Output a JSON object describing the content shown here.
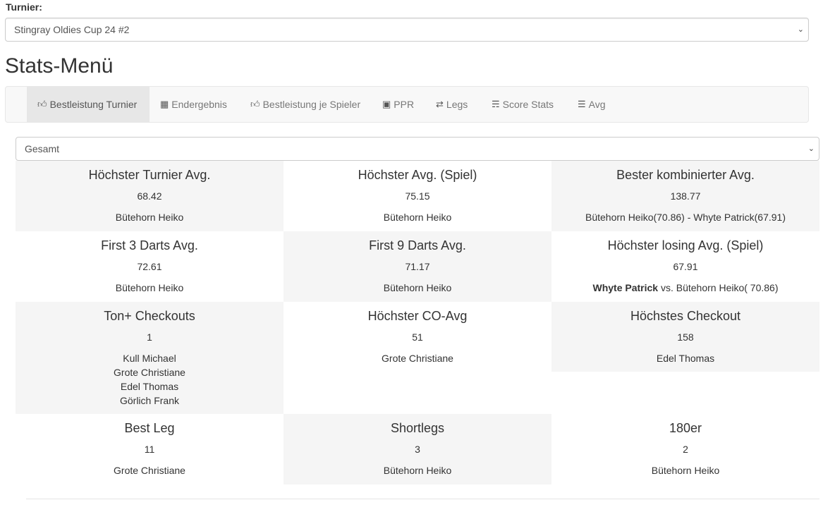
{
  "turnier": {
    "label": "Turnier:",
    "selected": "Stingray Oldies Cup 24 #2"
  },
  "page_title": "Stats-Menü",
  "nav": [
    {
      "label": "Bestleistung Turnier",
      "icon": "thumbs-up-icon",
      "active": true
    },
    {
      "label": "Endergebnis",
      "icon": "calendar-icon",
      "active": false
    },
    {
      "label": "Bestleistung je Spieler",
      "icon": "thumbs-up-icon",
      "active": false
    },
    {
      "label": "PPR",
      "icon": "ppr-icon",
      "active": false
    },
    {
      "label": "Legs",
      "icon": "random-icon",
      "active": false
    },
    {
      "label": "Score Stats",
      "icon": "tasks-icon",
      "active": false
    },
    {
      "label": "Avg",
      "icon": "list-icon",
      "active": false
    }
  ],
  "filter": {
    "selected": "Gesamt"
  },
  "stats": [
    {
      "title": "Höchster Turnier Avg.",
      "value": "68.42",
      "names": [
        "Bütehorn Heiko"
      ]
    },
    {
      "title": "Höchster Avg. (Spiel)",
      "value": "75.15",
      "names": [
        "Bütehorn Heiko"
      ]
    },
    {
      "title": "Bester kombinierter Avg.",
      "value": "138.77",
      "names": [
        "Bütehorn Heiko(70.86) - Whyte Patrick(67.91)"
      ]
    },
    {
      "title": "First 3 Darts Avg.",
      "value": "72.61",
      "names": [
        "Bütehorn Heiko"
      ]
    },
    {
      "title": "First 9 Darts Avg.",
      "value": "71.17",
      "names": [
        "Bütehorn Heiko"
      ]
    },
    {
      "title": "Höchster losing Avg. (Spiel)",
      "value": "67.91",
      "loser": "Whyte Patrick",
      "rest": " vs. Bütehorn Heiko( 70.86)"
    },
    {
      "title": "Ton+ Checkouts",
      "value": "1",
      "names": [
        "Kull Michael",
        "Grote Christiane",
        "Edel Thomas",
        "Görlich Frank"
      ]
    },
    {
      "title": "Höchster CO-Avg",
      "value": "51",
      "names": [
        "Grote Christiane"
      ]
    },
    {
      "title": "Höchstes Checkout",
      "value": "158",
      "names": [
        "Edel Thomas"
      ]
    },
    {
      "title": "Best Leg",
      "value": "11",
      "names": [
        "Grote Christiane"
      ]
    },
    {
      "title": "Shortlegs",
      "value": "3",
      "names": [
        "Bütehorn Heiko"
      ]
    },
    {
      "title": "180er",
      "value": "2",
      "names": [
        "Bütehorn Heiko"
      ]
    }
  ]
}
